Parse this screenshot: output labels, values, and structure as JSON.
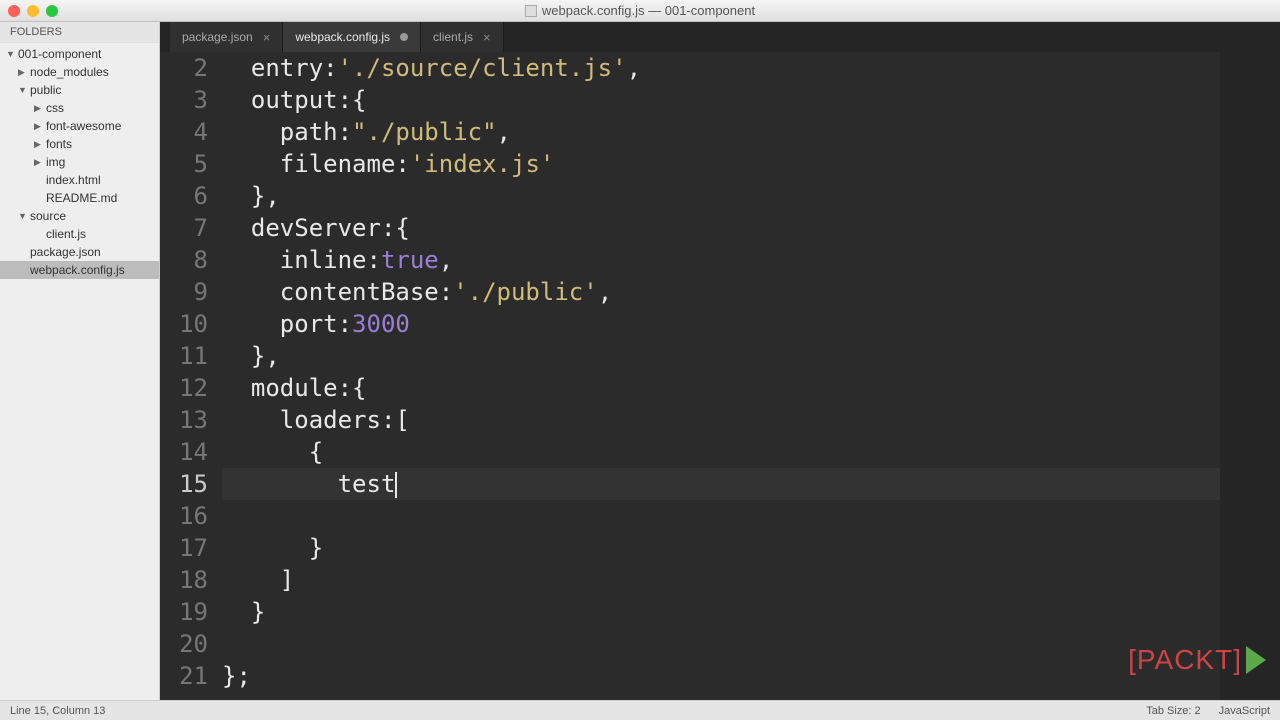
{
  "window": {
    "title": "webpack.config.js — 001-component"
  },
  "sidebar": {
    "header": "FOLDERS",
    "items": [
      {
        "label": "001-component",
        "kind": "folder",
        "open": true,
        "depth": 0
      },
      {
        "label": "node_modules",
        "kind": "folder",
        "open": false,
        "depth": 1
      },
      {
        "label": "public",
        "kind": "folder",
        "open": true,
        "depth": 1
      },
      {
        "label": "css",
        "kind": "folder",
        "open": false,
        "depth": 2
      },
      {
        "label": "font-awesome",
        "kind": "folder",
        "open": false,
        "depth": 2
      },
      {
        "label": "fonts",
        "kind": "folder",
        "open": false,
        "depth": 2
      },
      {
        "label": "img",
        "kind": "folder",
        "open": false,
        "depth": 2
      },
      {
        "label": "index.html",
        "kind": "file",
        "depth": 2
      },
      {
        "label": "README.md",
        "kind": "file",
        "depth": 2
      },
      {
        "label": "source",
        "kind": "folder",
        "open": true,
        "depth": 1
      },
      {
        "label": "client.js",
        "kind": "file",
        "depth": 2
      },
      {
        "label": "package.json",
        "kind": "file",
        "depth": 1
      },
      {
        "label": "webpack.config.js",
        "kind": "file",
        "depth": 1,
        "selected": true
      }
    ]
  },
  "tabs": [
    {
      "label": "package.json",
      "active": false,
      "dirty": false
    },
    {
      "label": "webpack.config.js",
      "active": true,
      "dirty": true
    },
    {
      "label": "client.js",
      "active": false,
      "dirty": false
    }
  ],
  "code": {
    "first_line": 2,
    "active_line": 15,
    "lines": [
      {
        "tokens": [
          {
            "t": "  entry:"
          },
          {
            "t": "'./source/client.js'",
            "c": "str"
          },
          {
            "t": ","
          }
        ]
      },
      {
        "tokens": [
          {
            "t": "  output:{"
          }
        ]
      },
      {
        "tokens": [
          {
            "t": "    path:"
          },
          {
            "t": "\"./public\"",
            "c": "str"
          },
          {
            "t": ","
          }
        ]
      },
      {
        "tokens": [
          {
            "t": "    filename:"
          },
          {
            "t": "'index.js'",
            "c": "str"
          }
        ]
      },
      {
        "tokens": [
          {
            "t": "  },"
          }
        ]
      },
      {
        "tokens": [
          {
            "t": "  devServer:{"
          }
        ]
      },
      {
        "tokens": [
          {
            "t": "    inline:"
          },
          {
            "t": "true",
            "c": "const"
          },
          {
            "t": ","
          }
        ]
      },
      {
        "tokens": [
          {
            "t": "    contentBase:"
          },
          {
            "t": "'./public'",
            "c": "str"
          },
          {
            "t": ","
          }
        ]
      },
      {
        "tokens": [
          {
            "t": "    port:"
          },
          {
            "t": "3000",
            "c": "const"
          }
        ]
      },
      {
        "tokens": [
          {
            "t": "  },"
          }
        ]
      },
      {
        "tokens": [
          {
            "t": "  module:{"
          }
        ]
      },
      {
        "tokens": [
          {
            "t": "    loaders:["
          }
        ]
      },
      {
        "tokens": [
          {
            "t": "      {"
          }
        ]
      },
      {
        "tokens": [
          {
            "t": "        test"
          }
        ],
        "cursor": true
      },
      {
        "tokens": [
          {
            "t": ""
          }
        ]
      },
      {
        "tokens": [
          {
            "t": "      }"
          }
        ]
      },
      {
        "tokens": [
          {
            "t": "    ]"
          }
        ]
      },
      {
        "tokens": [
          {
            "t": "  }"
          }
        ]
      },
      {
        "tokens": [
          {
            "t": ""
          }
        ]
      },
      {
        "tokens": [
          {
            "t": "};"
          }
        ]
      }
    ]
  },
  "status": {
    "position": "Line 15, Column 13",
    "tab_size": "Tab Size: 2",
    "language": "JavaScript"
  },
  "watermark": {
    "text": "[PACKT]"
  }
}
